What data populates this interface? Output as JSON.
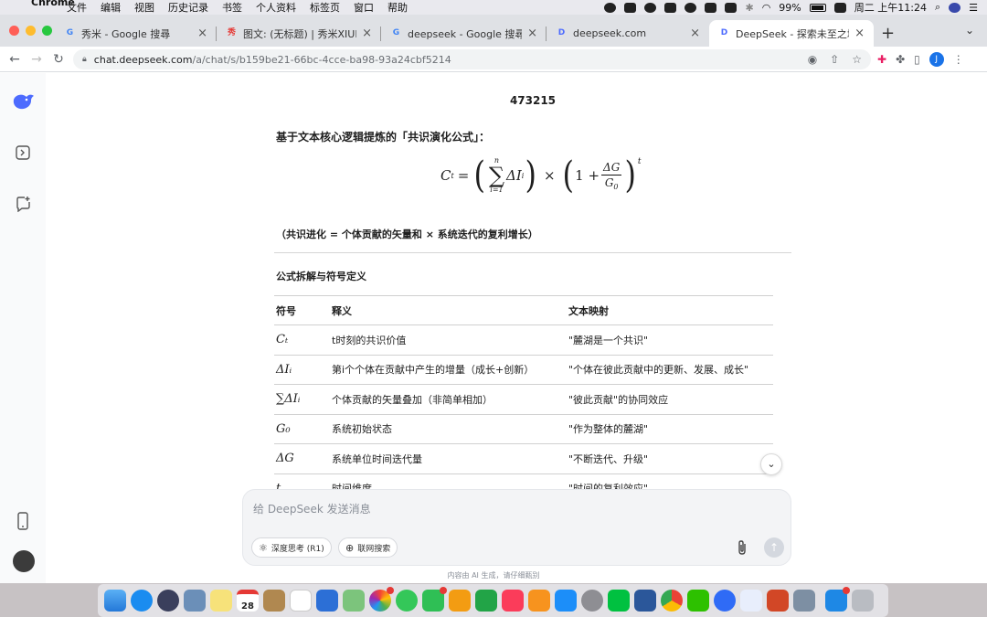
{
  "menubar": {
    "app_name": "Chrome",
    "items": [
      "文件",
      "编辑",
      "视图",
      "历史记录",
      "书签",
      "个人资料",
      "标签页",
      "窗口",
      "帮助"
    ],
    "battery": "99%",
    "clock": "周二 上午11:24"
  },
  "tabs": [
    {
      "title": "秀米 - Google 搜尋",
      "favicon": "G",
      "color": "#4285f4"
    },
    {
      "title": "图文: (无标题) | 秀米XIUMI",
      "favicon": "秀",
      "color": "#e53935"
    },
    {
      "title": "deepseek - Google 搜尋",
      "favicon": "G",
      "color": "#4285f4"
    },
    {
      "title": "deepseek.com",
      "favicon": "D",
      "color": "#4d6bfe"
    },
    {
      "title": "DeepSeek - 探索未至之境",
      "favicon": "D",
      "color": "#4d6bfe",
      "active": true
    }
  ],
  "address": {
    "host": "chat.deepseek.com",
    "path": "/a/chat/s/b159be21-66bc-4cce-ba98-93a24cbf5214"
  },
  "profile_initial": "J",
  "chat": {
    "title_number": "473215",
    "heading": "基于文本核心逻辑提炼的「共识演化公式」：",
    "formula": {
      "lhs": "C",
      "lhs_sub": "t",
      "sum_upper": "n",
      "sum_lower": "i=1",
      "term": "ΔI",
      "term_sub": "i",
      "times": "×",
      "one_plus": "1 +",
      "frac_num": "ΔG",
      "frac_den": "G",
      "frac_den_sub": "0",
      "exponent": "t"
    },
    "note": "（共识进化 = 个体贡献的矢量和 × 系统迭代的复利增长）",
    "section_title": "公式拆解与符号定义",
    "table": {
      "headers": [
        "符号",
        "释义",
        "文本映射"
      ],
      "rows": [
        {
          "symbol": "Cₜ",
          "meaning": "t时刻的共识价值",
          "mapping": "\"麓湖是一个共识\""
        },
        {
          "symbol": "ΔIᵢ",
          "meaning": "第i个个体在贡献中产生的增量（成长+创新）",
          "mapping": "\"个体在彼此贡献中的更新、发展、成长\""
        },
        {
          "symbol": "∑ΔIᵢ",
          "meaning": "个体贡献的矢量叠加（非简单相加）",
          "mapping": "\"彼此贡献\"的协同效应"
        },
        {
          "symbol": "G₀",
          "meaning": "系统初始状态",
          "mapping": "\"作为整体的麓湖\""
        },
        {
          "symbol": "ΔG",
          "meaning": "系统单位时间迭代量",
          "mapping": "\"不断迭代、升级\""
        },
        {
          "symbol": "t",
          "meaning": "时间维度",
          "mapping": "\"时间的复利效应\""
        }
      ]
    }
  },
  "composer": {
    "placeholder": "给 DeepSeek 发送消息",
    "deep_think": "深度思考 (R1)",
    "web_search": "联网搜索"
  },
  "disclaimer": "内容由 AI 生成，请仔细甄别",
  "colors": {
    "accent": "#4d6bfe",
    "tab_strip": "#dfe1e5",
    "composer_bg": "#f3f4f6"
  },
  "dock_apps": [
    "finder-icon",
    "safari-icon",
    "launchpad-icon",
    "preview-icon",
    "notes-icon",
    "calendar-icon",
    "archive-icon",
    "reminders-icon",
    "keynote-icon",
    "maps-icon",
    "photos-icon",
    "messages-icon",
    "facetime-icon",
    "pages-icon",
    "numbers-icon",
    "music-icon",
    "books-icon",
    "appstore-icon",
    "settings-icon",
    "iqiyi-icon",
    "word-icon",
    "chrome-icon",
    "wechat-icon",
    "quark-icon",
    "baidu-netdisk-icon",
    "powerpoint-icon",
    "screenshot-icon",
    "cloud-icon",
    "trash-icon"
  ],
  "calendar_day": "28"
}
